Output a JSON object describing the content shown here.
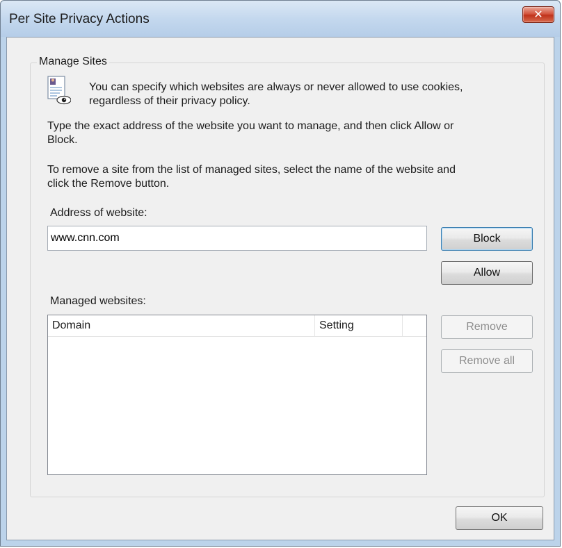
{
  "window": {
    "title": "Per Site Privacy Actions",
    "close_glyph": "✕"
  },
  "manage_sites": {
    "group_title": "Manage Sites",
    "intro_line1": "You can specify which websites are always or never allowed to use cookies,",
    "intro_line2": "regardless of their privacy policy.",
    "instruction_line1": "Type the exact address of the website you want to manage, and then click Allow or",
    "instruction_line2": "Block.",
    "remove_line1": "To remove a site from the list of managed sites, select the name of the website and",
    "remove_line2": "click the Remove button.",
    "address_label": "Address of website:",
    "address_value": "www.cnn.com",
    "managed_label": "Managed websites:",
    "columns": [
      "Domain",
      "Setting"
    ],
    "rows": []
  },
  "buttons": {
    "block": "Block",
    "allow": "Allow",
    "remove": "Remove",
    "remove_all": "Remove all",
    "ok": "OK"
  },
  "icons": {
    "info": "privacy-document-eye-icon",
    "close": "close-icon"
  }
}
